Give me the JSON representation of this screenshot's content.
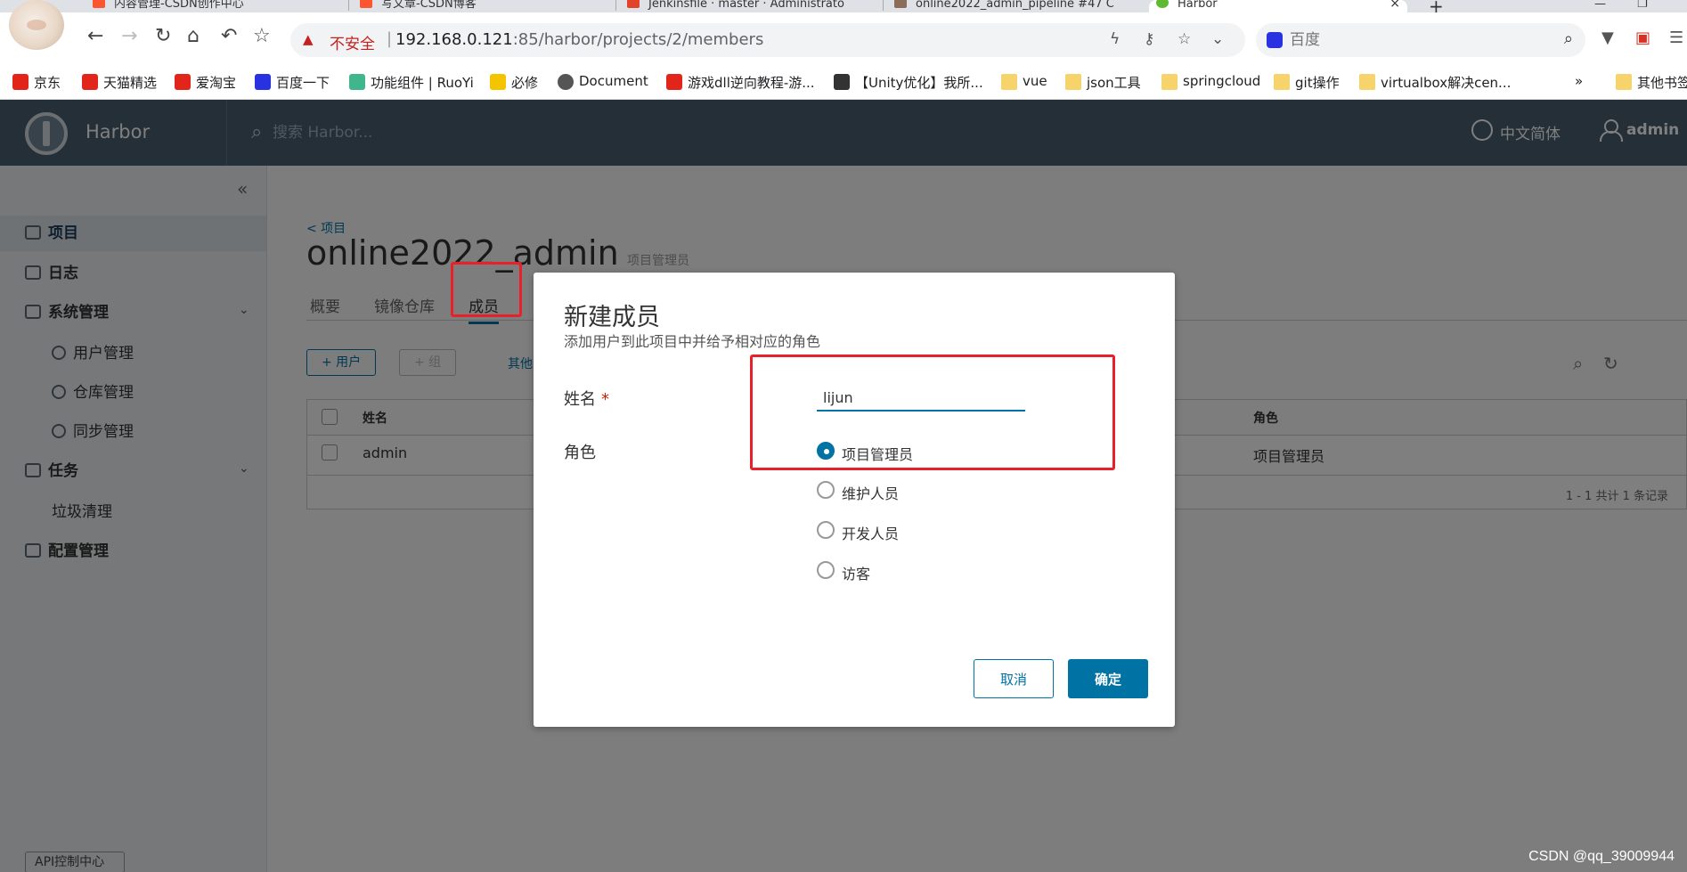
{
  "browser": {
    "tabs": [
      {
        "title": "内容管理-CSDN创作中心",
        "color": "#fc5531"
      },
      {
        "title": "写文章-CSDN博客",
        "color": "#fc5531"
      },
      {
        "title": "Jenkinsfile · master · Administrato",
        "color": "#e24329"
      },
      {
        "title": "online2022_admin_pipeline #47 C",
        "color": "#8c6d5a"
      },
      {
        "title": "Harbor",
        "color": "#60b932"
      }
    ],
    "new_tab": "+",
    "close_tab": "×",
    "address": {
      "insecure_label": "不安全",
      "host": "192.168.0.121",
      "path": ":85/harbor/projects/2/members"
    },
    "search_placeholder": "百度",
    "bookmarks": [
      {
        "label": "京东",
        "color": "#e1251b"
      },
      {
        "label": "天猫精选",
        "color": "#e1251b"
      },
      {
        "label": "爱淘宝",
        "color": "#e1251b"
      },
      {
        "label": "百度一下",
        "color": "#2932e1"
      },
      {
        "label": "功能组件 | RuoYi",
        "color": "#3fb68b"
      },
      {
        "label": "必修",
        "color": "#f5c400"
      },
      {
        "label": "Document",
        "color": "#555555"
      },
      {
        "label": "游戏dll逆向教程-游...",
        "color": "#e1251b"
      },
      {
        "label": "【Unity优化】我所...",
        "color": "#333333"
      },
      {
        "label": "vue",
        "folder": true
      },
      {
        "label": "json工具",
        "folder": true
      },
      {
        "label": "springcloud",
        "folder": true
      },
      {
        "label": "git操作",
        "folder": true
      },
      {
        "label": "virtualbox解决cen...",
        "folder": true
      }
    ],
    "bookmarks_more": "»",
    "other_bookmarks": "其他书签"
  },
  "harbor": {
    "title": "Harbor",
    "search_placeholder": "搜索 Harbor...",
    "language": "中文简体",
    "user": "admin",
    "sidebar": {
      "projects": "项目",
      "logs": "日志",
      "admin": "系统管理",
      "users": "用户管理",
      "registries": "仓库管理",
      "replication": "同步管理",
      "tasks": "任务",
      "gc": "垃圾清理",
      "config": "配置管理",
      "api": "API控制中心"
    },
    "breadcrumb": "< 项目",
    "project_name": "online2022_admin",
    "project_role": "项目管理员",
    "tabs": [
      "概要",
      "镜像仓库",
      "成员"
    ],
    "toolbar": {
      "add_user": "+ 用户",
      "add_group": "+ 组",
      "more": "其他"
    },
    "table": {
      "col_name": "姓名",
      "col_role": "角色",
      "rows": [
        {
          "name": "admin",
          "role": "项目管理员"
        }
      ],
      "footer": "1 - 1 共计 1 条记录"
    }
  },
  "modal": {
    "title": "新建成员",
    "description": "添加用户到此项目中并给予相对应的角色",
    "name_label": "姓名",
    "required_mark": "*",
    "name_value": "lijun",
    "role_label": "角色",
    "roles": [
      {
        "label": "项目管理员",
        "checked": true
      },
      {
        "label": "维护人员",
        "checked": false
      },
      {
        "label": "开发人员",
        "checked": false
      },
      {
        "label": "访客",
        "checked": false
      }
    ],
    "cancel": "取消",
    "confirm": "确定"
  },
  "watermark": "CSDN @qq_39009944",
  "colors": {
    "harbor_header": "#485f6f",
    "primary": "#0072a3",
    "annotation": "#e8202a"
  }
}
